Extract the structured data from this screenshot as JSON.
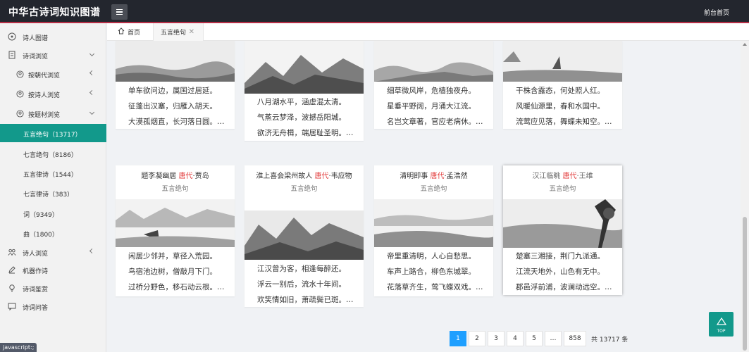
{
  "header": {
    "logo": "中华古诗词知识图谱",
    "home_link": "前台首页"
  },
  "sidebar": {
    "items": [
      {
        "label": "诗人图谱",
        "icon": "graph-icon"
      },
      {
        "label": "诗词浏览",
        "icon": "document-icon"
      },
      {
        "label": "按朝代浏览",
        "icon": "circle-user-icon"
      },
      {
        "label": "按诗人浏览",
        "icon": "circle-user-icon"
      },
      {
        "label": "按题材浏览",
        "icon": "circle-user-icon"
      },
      {
        "label": "五言绝句（13717）"
      },
      {
        "label": "七言绝句（8186）"
      },
      {
        "label": "五言律诗（1544）"
      },
      {
        "label": "七言律诗（383）"
      },
      {
        "label": "词（9349）"
      },
      {
        "label": "曲（1800）"
      },
      {
        "label": "诗人浏览",
        "icon": "group-icon"
      },
      {
        "label": "机器作诗",
        "icon": "pen-icon"
      },
      {
        "label": "诗词鉴赏",
        "icon": "bulb-icon"
      },
      {
        "label": "诗词问答",
        "icon": "chat-icon"
      }
    ]
  },
  "tabs": {
    "home": "首页",
    "current": "五言绝句"
  },
  "row1": [
    {
      "lines": [
        "单车欲问边，属国过居延。",
        "征蓬出汉塞，归雁入胡天。",
        "大漠孤烟直，长河落日圆。…"
      ]
    },
    {
      "lines": [
        "八月湖水平，涵虚混太清。",
        "气蒸云梦泽，波撼岳阳城。",
        "欲济无舟楫，端居耻圣明。…"
      ]
    },
    {
      "lines": [
        "细草微风岸，危樯独夜舟。",
        "星垂平野阔，月涌大江流。",
        "名岂文章著，官应老病休。…"
      ]
    },
    {
      "lines": [
        "干株含露态，何处照人红。",
        "风暖仙源里，春和水国中。",
        "流莺应见落，舞蝶未知空。…"
      ]
    }
  ],
  "row2": [
    {
      "title": "题李凝幽居",
      "dynasty": "唐代",
      "author": "·贾岛",
      "type": "五言绝句",
      "lines": [
        "闲居少邻并，草径入荒园。",
        "鸟宿池边树，僧敲月下门。",
        "过桥分野色，移石动云根。…"
      ]
    },
    {
      "title": "淮上喜会梁州故人",
      "dynasty": "唐代",
      "author": "·韦应物",
      "type": "五言绝句",
      "lines": [
        "江汉曾为客，相逢每醉还。",
        "浮云一别后，流水十年间。",
        "欢笑情如旧，萧疏鬓已斑。…"
      ]
    },
    {
      "title": "清明即事",
      "dynasty": "唐代",
      "author": "·孟浩然",
      "type": "五言绝句",
      "lines": [
        "帝里重清明，人心自愁思。",
        "车声上路合，柳色东城翠。",
        "花落草齐生，莺飞蝶双戏。…"
      ]
    },
    {
      "title": "汉江临眺",
      "dynasty": "唐代",
      "author": "·王维",
      "type": "五言绝句",
      "lines": [
        "楚塞三湘接，荆门九派通。",
        "江流天地外，山色有无中。",
        "郡邑浮前浦，波澜动远空。…"
      ]
    }
  ],
  "pagination": {
    "pages": [
      "1",
      "2",
      "3",
      "4",
      "5",
      "…",
      "858"
    ],
    "current": "1",
    "total": "共 13717 条"
  },
  "totop": "TOP",
  "status_bar": "javascript:;",
  "colors": {
    "accent": "#12998b",
    "header": "#23262e",
    "active_page": "#1e9fff",
    "dynasty": "#e23a3a"
  }
}
